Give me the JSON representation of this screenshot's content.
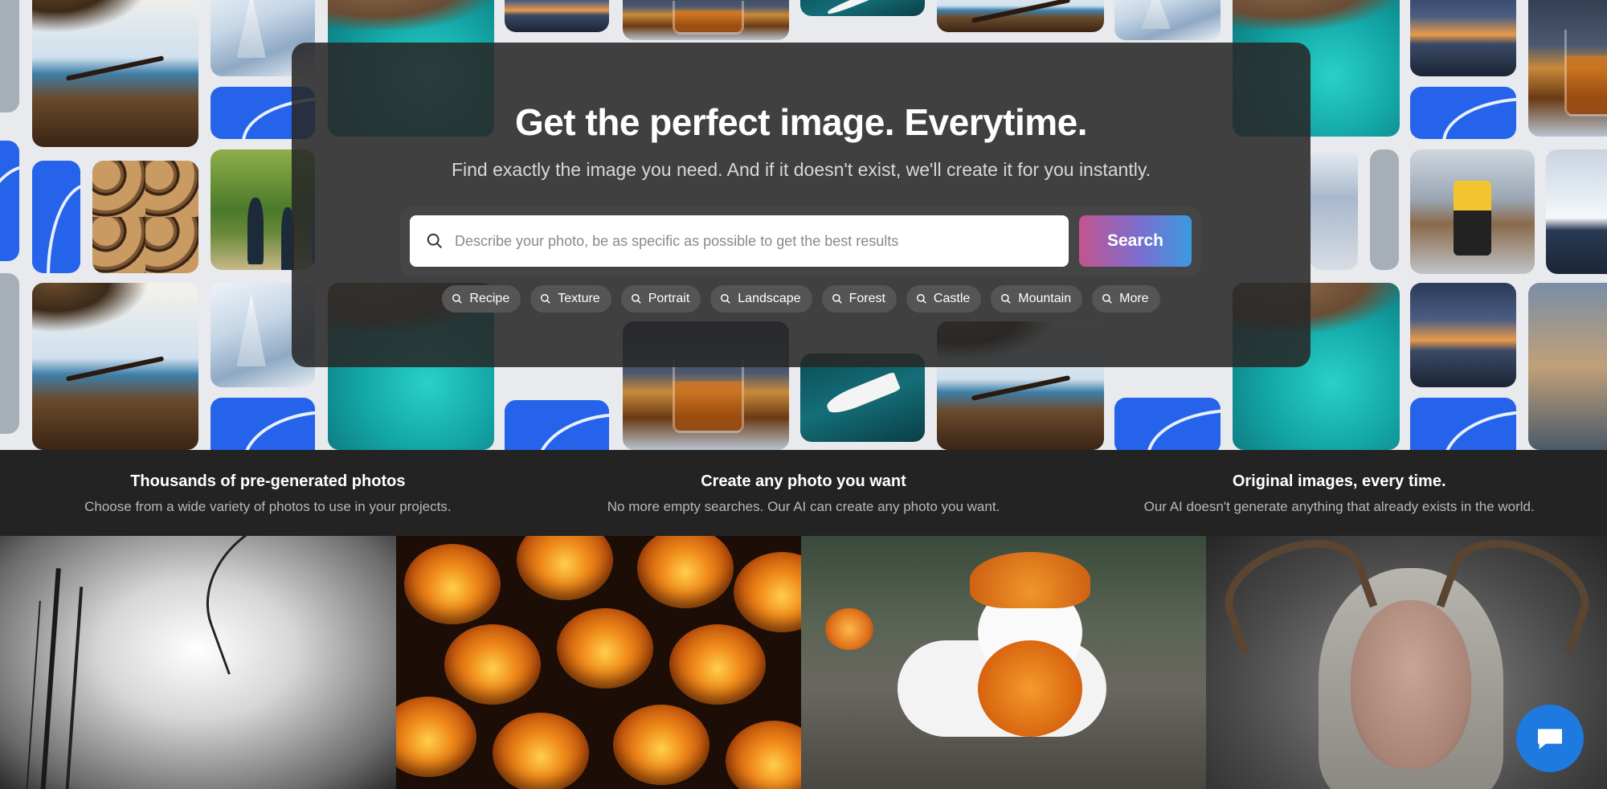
{
  "hero": {
    "headline": "Get the perfect image. Everytime.",
    "subheadline": "Find exactly the image you need. And if it doesn't exist, we'll create it for you instantly.",
    "search": {
      "placeholder": "Describe your photo, be as specific as possible to get the best results",
      "value": "",
      "button_label": "Search"
    },
    "chips": [
      "Recipe",
      "Texture",
      "Portrait",
      "Landscape",
      "Forest",
      "Castle",
      "Mountain",
      "More"
    ]
  },
  "features": [
    {
      "title": "Thousands of pre-generated photos",
      "description": "Choose from a wide variety of photos to use in your projects."
    },
    {
      "title": "Create any photo you want",
      "description": "No more empty searches. Our AI can create any photo you want."
    },
    {
      "title": "Original images, every time.",
      "description": "Our AI doesn't generate anything that already exists in the world."
    }
  ],
  "gallery": [
    "foggy-bare-trees",
    "jack-o-lanterns",
    "dog-in-pumpkin-costume",
    "woman-with-antlers"
  ],
  "colors": {
    "search_button_gradient": [
      "#c2548e",
      "#7a6fd0",
      "#3a9ae0"
    ],
    "chat_button": "#1f7ae0",
    "feature_bar": "#232323"
  },
  "icons": {
    "search": "magnifier-icon",
    "chat": "chat-bubble-icon"
  }
}
